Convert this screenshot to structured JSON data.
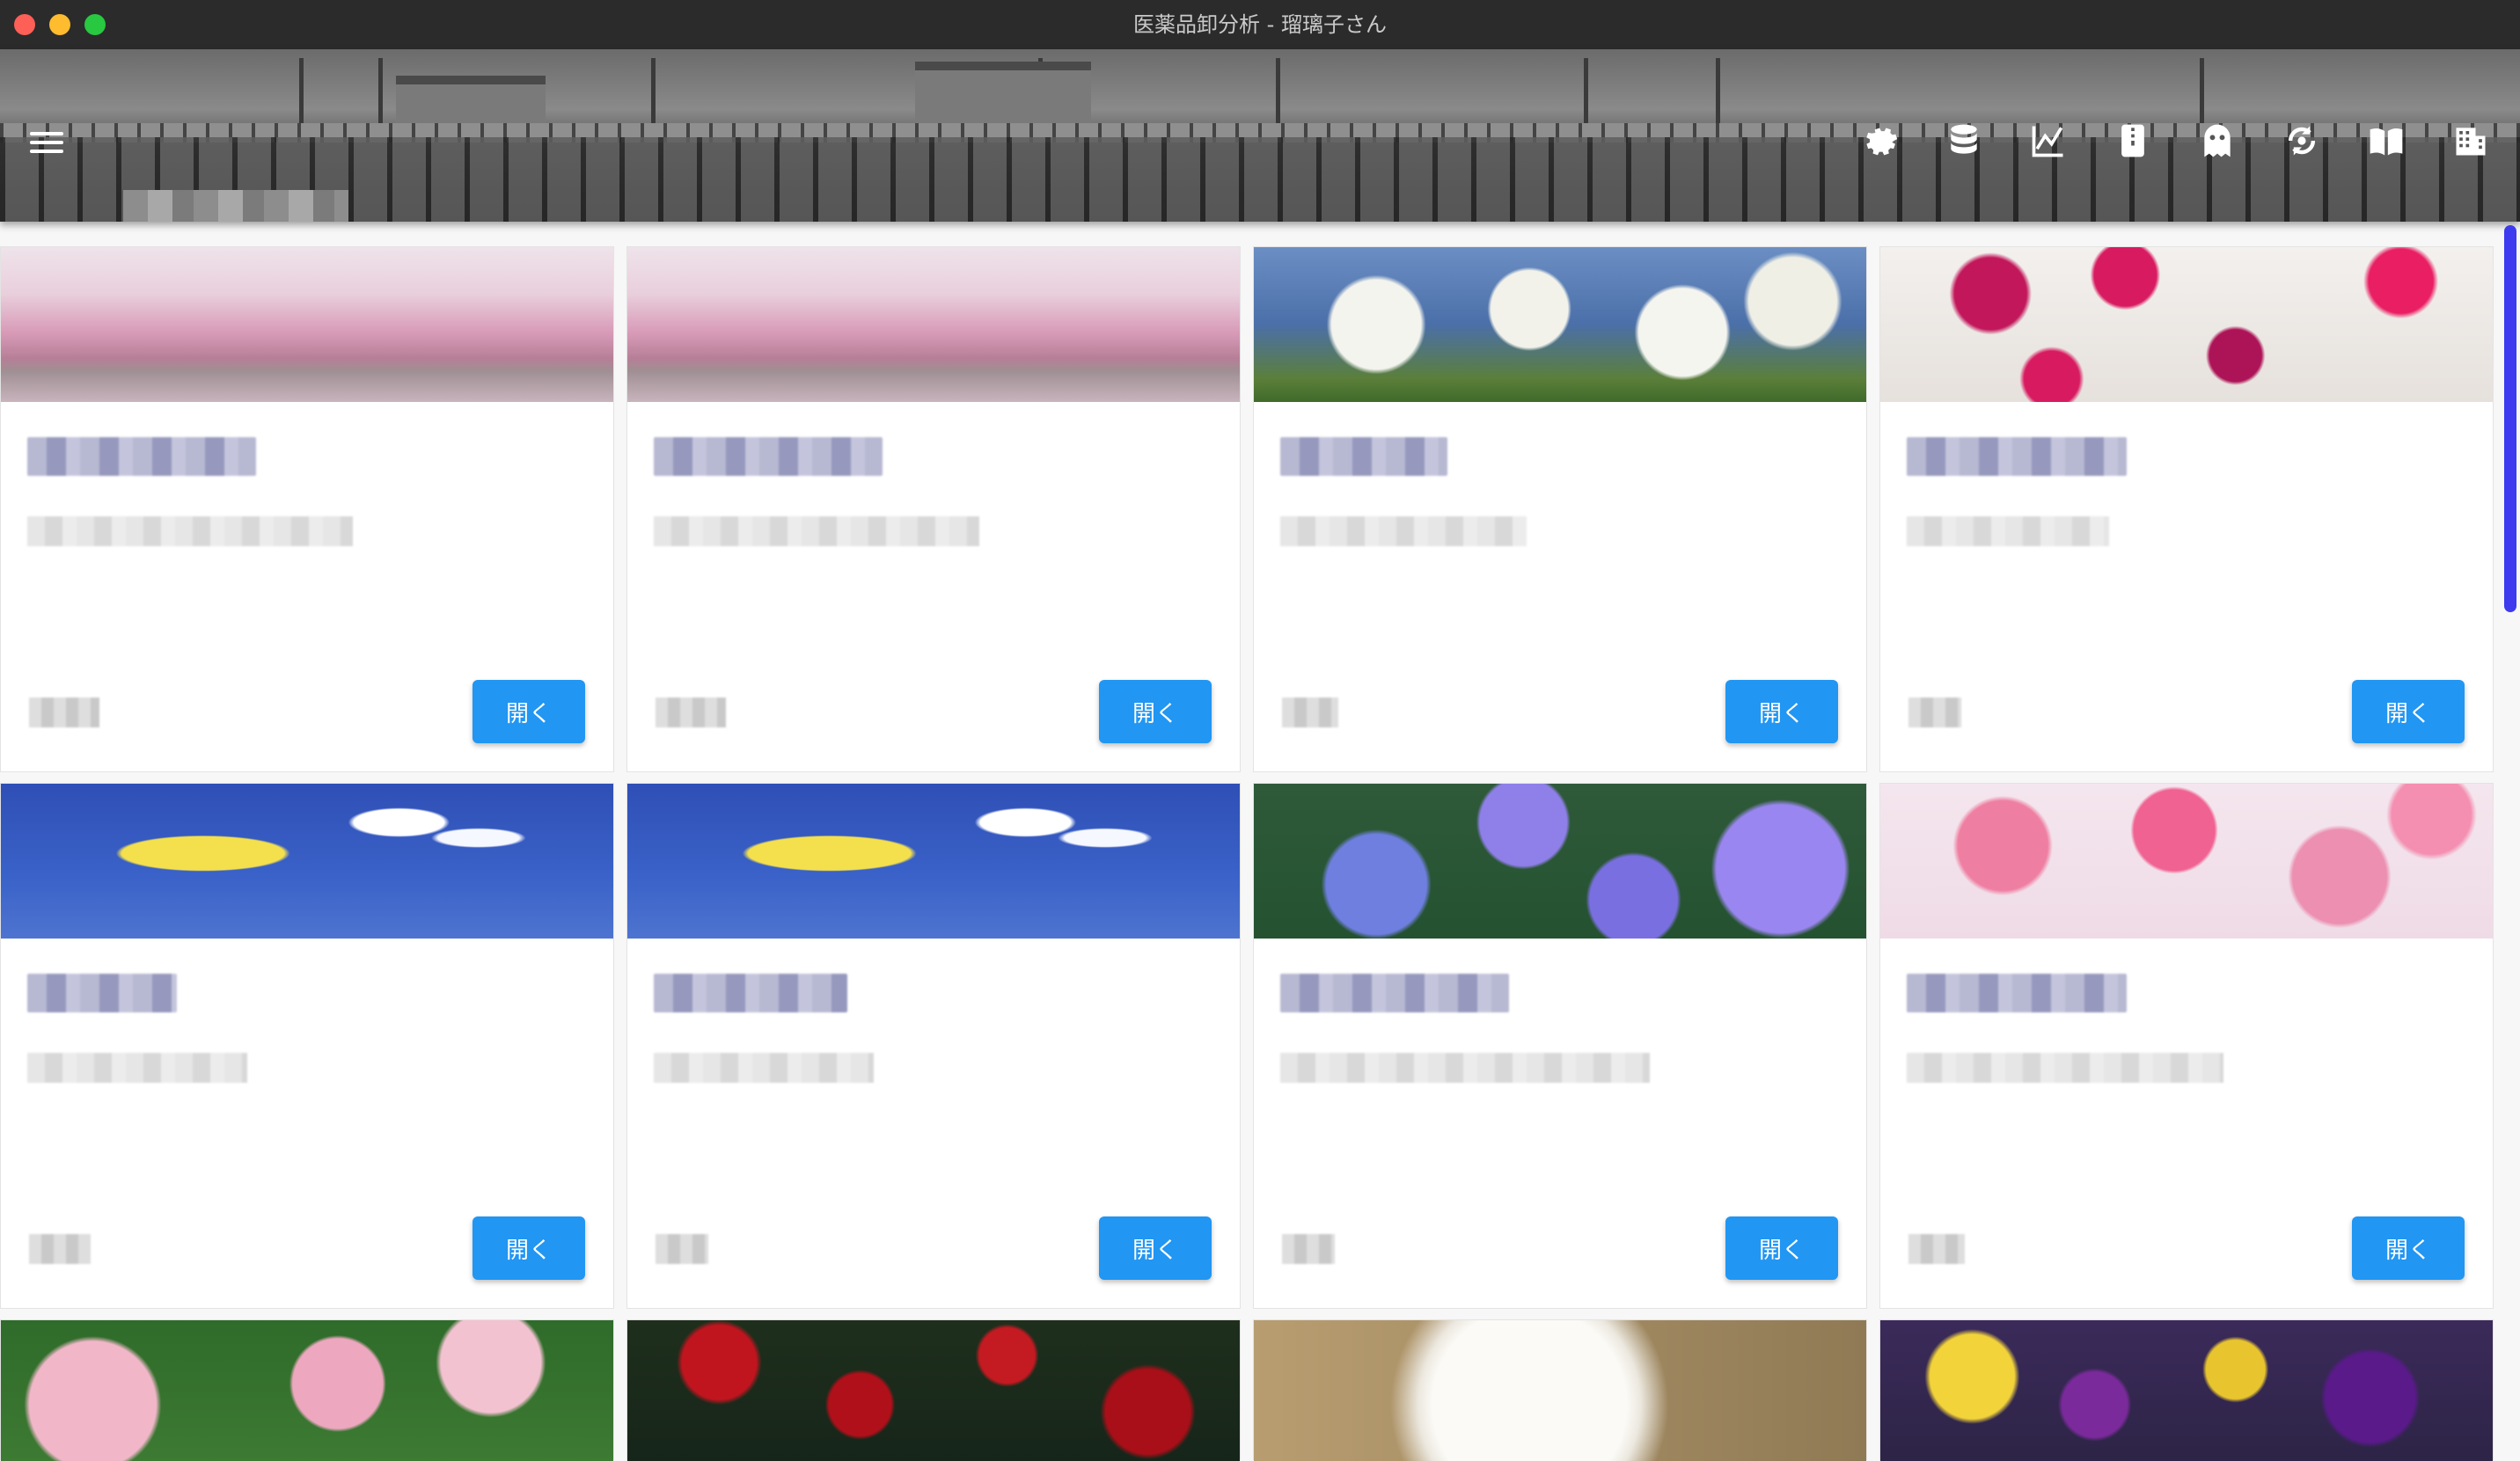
{
  "window": {
    "title": "医薬品卸分析 - 瑠璃子さん"
  },
  "header": {
    "menu_icon": "hamburger-menu-icon",
    "icons": [
      "gear-icon",
      "database-icon",
      "line-chart-icon",
      "zip-file-icon",
      "ghost-icon",
      "sync-icon",
      "book-icon",
      "building-icon"
    ]
  },
  "cards": [
    {
      "image": "cherry-blossom-lake",
      "button": "開く"
    },
    {
      "image": "cherry-blossom-lake",
      "button": "開く"
    },
    {
      "image": "dogwood-blossoms",
      "button": "開く"
    },
    {
      "image": "carnations",
      "button": "開く"
    },
    {
      "image": "daffodil-sky",
      "button": "開く"
    },
    {
      "image": "daffodil-sky",
      "button": "開く"
    },
    {
      "image": "hydrangea",
      "button": "開く"
    },
    {
      "image": "pink-cherry",
      "button": "開く"
    },
    {
      "image": "pink-oleander",
      "button": ""
    },
    {
      "image": "red-roses",
      "button": ""
    },
    {
      "image": "white-gardenia",
      "button": ""
    },
    {
      "image": "pansies",
      "button": ""
    }
  ],
  "colors": {
    "accent": "#2196f3",
    "scrollbar": "#3d3af0",
    "titlebar": "#2b2b2b"
  }
}
